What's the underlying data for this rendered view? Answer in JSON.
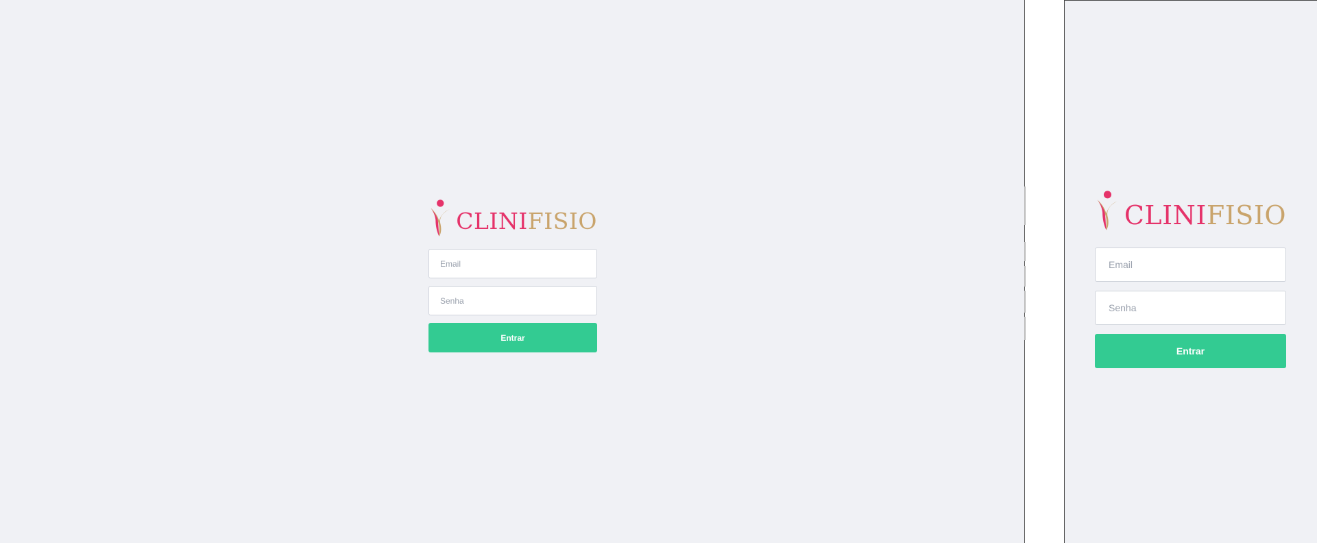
{
  "brand": {
    "part1": "CLINI",
    "part2": "FISIO",
    "colors": {
      "primary": "#e5336a",
      "secondary": "#c9a46c"
    }
  },
  "login": {
    "email_placeholder": "Email",
    "password_placeholder": "Senha",
    "submit_label": "Entrar"
  },
  "theme": {
    "background": "#f0f1f5",
    "button": "#33cb92"
  }
}
